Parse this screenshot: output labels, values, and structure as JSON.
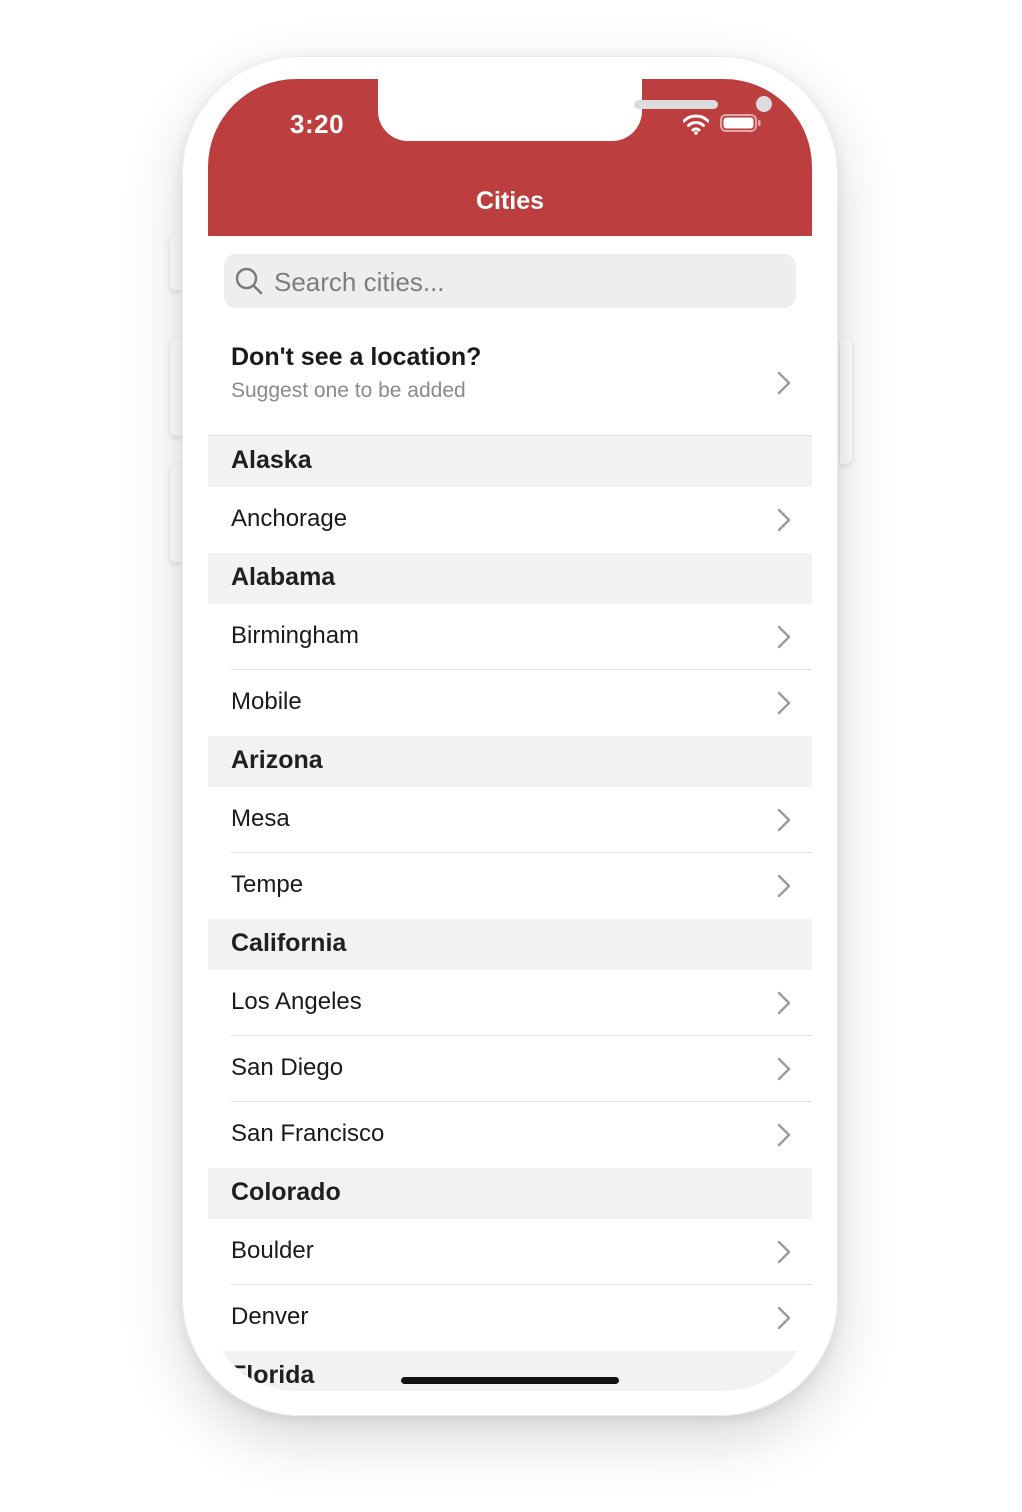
{
  "status_bar": {
    "time": "3:20"
  },
  "nav": {
    "title": "Cities"
  },
  "search": {
    "placeholder": "Search cities..."
  },
  "suggest": {
    "title": "Don't see a location?",
    "subtitle": "Suggest one to be added"
  },
  "sections": [
    {
      "state": "Alaska",
      "cities": [
        "Anchorage"
      ]
    },
    {
      "state": "Alabama",
      "cities": [
        "Birmingham",
        "Mobile"
      ]
    },
    {
      "state": "Arizona",
      "cities": [
        "Mesa",
        "Tempe"
      ]
    },
    {
      "state": "California",
      "cities": [
        "Los Angeles",
        "San Diego",
        "San Francisco"
      ]
    },
    {
      "state": "Colorado",
      "cities": [
        "Boulder",
        "Denver"
      ]
    },
    {
      "state": "Florida",
      "cities": []
    }
  ],
  "colors": {
    "header": "#bd3e3e",
    "section_bg": "#f2f2f2",
    "search_bg": "#eeeeee"
  },
  "icons": {
    "search": "magnifier-icon",
    "chevron": "chevron-right-icon",
    "wifi": "wifi-icon",
    "battery": "battery-icon"
  }
}
